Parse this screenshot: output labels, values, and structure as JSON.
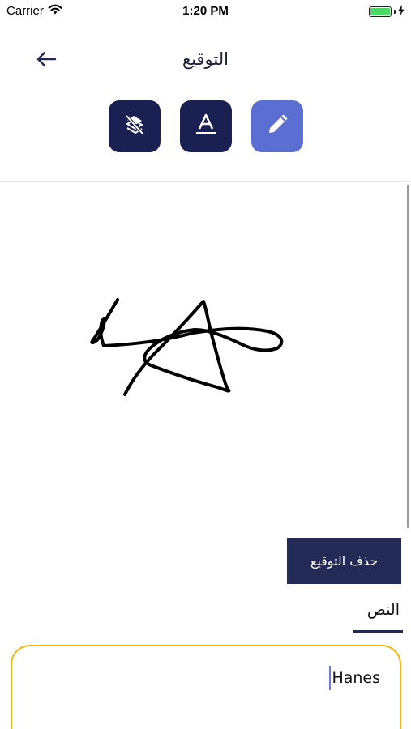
{
  "status_bar": {
    "carrier": "Carrier",
    "time": "1:20 PM",
    "battery_level": 1.0
  },
  "header": {
    "title": "التوقيع",
    "back_icon": "arrow-left-icon"
  },
  "mode_buttons": [
    {
      "name": "clear-style",
      "icon": "eraser-icon",
      "color": "#1a2152"
    },
    {
      "name": "text",
      "icon": "text-underline-icon",
      "color": "#1a2152"
    },
    {
      "name": "draw",
      "icon": "pencil-icon",
      "color": "#5b6ed1",
      "active": true
    }
  ],
  "actions": {
    "delete_signature": "حذف التوقيع"
  },
  "text_section": {
    "tab_label": "النص",
    "input_value": "Hanes"
  },
  "colors": {
    "navy": "#232a55",
    "active_blue": "#5b6ed1",
    "input_border": "#f2b619"
  }
}
